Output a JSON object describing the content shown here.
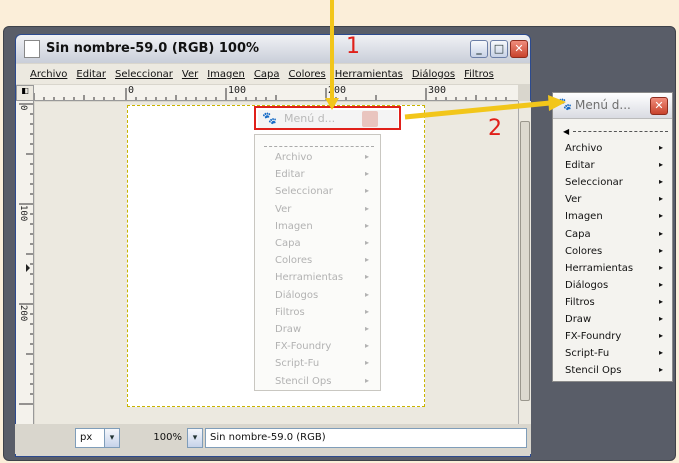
{
  "window": {
    "title": "Sin nombre-59.0 (RGB) 100%",
    "minimize": "_",
    "maximize": "□",
    "close": "✕"
  },
  "menubar": [
    "Archivo",
    "Editar",
    "Seleccionar",
    "Ver",
    "Imagen",
    "Capa",
    "Colores",
    "Herramientas",
    "Diálogos",
    "Filtros"
  ],
  "ruler": {
    "h_labels": [
      "0",
      "100",
      "200",
      "300"
    ],
    "v_labels": [
      "0",
      "100",
      "200"
    ]
  },
  "statusbar": {
    "unit": "px",
    "zoom": "100%",
    "image_name": "Sin nombre-59.0 (RGB)"
  },
  "tearoff_faded": {
    "title": "Menú d...",
    "items": [
      "Archivo",
      "Editar",
      "Seleccionar",
      "Ver",
      "Imagen",
      "Capa",
      "Colores",
      "Herramientas",
      "Diálogos",
      "Filtros",
      "Draw",
      "FX-Foundry",
      "Script-Fu",
      "Stencil Ops"
    ]
  },
  "tearoff_window": {
    "title": "Menú d...",
    "items": [
      "Archivo",
      "Editar",
      "Seleccionar",
      "Ver",
      "Imagen",
      "Capa",
      "Colores",
      "Herramientas",
      "Diálogos",
      "Filtros",
      "Draw",
      "FX-Foundry",
      "Script-Fu",
      "Stencil Ops"
    ]
  },
  "annotations": {
    "step1": "1",
    "step2": "2",
    "arrow_color": "#f2c61a",
    "box_color": "#e0201a"
  }
}
